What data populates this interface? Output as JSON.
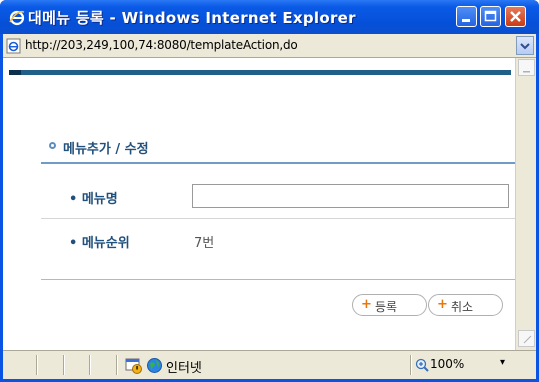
{
  "window": {
    "title": "대메뉴 등록 - Windows Internet Explorer",
    "icon": "ie-logo-icon"
  },
  "address_bar": {
    "url": "http://203,249,100,74:8080/templateAction,do"
  },
  "form": {
    "section_title": "메뉴추가 / 수정",
    "rows": [
      {
        "label": "• 메뉴명",
        "value": ""
      },
      {
        "label": "• 메뉴순위",
        "value": "7번"
      }
    ],
    "buttons": {
      "register_label": "등록",
      "cancel_label": "취소"
    }
  },
  "status_bar": {
    "zone_label": "인터넷",
    "zoom_label": "100%",
    "zoom_dropdown": "▾"
  },
  "colors": {
    "titlebar": "#0a54e3",
    "accent_label": "#21507c",
    "header_bar": "#1f5f88",
    "button_plus": "#e8760f"
  }
}
